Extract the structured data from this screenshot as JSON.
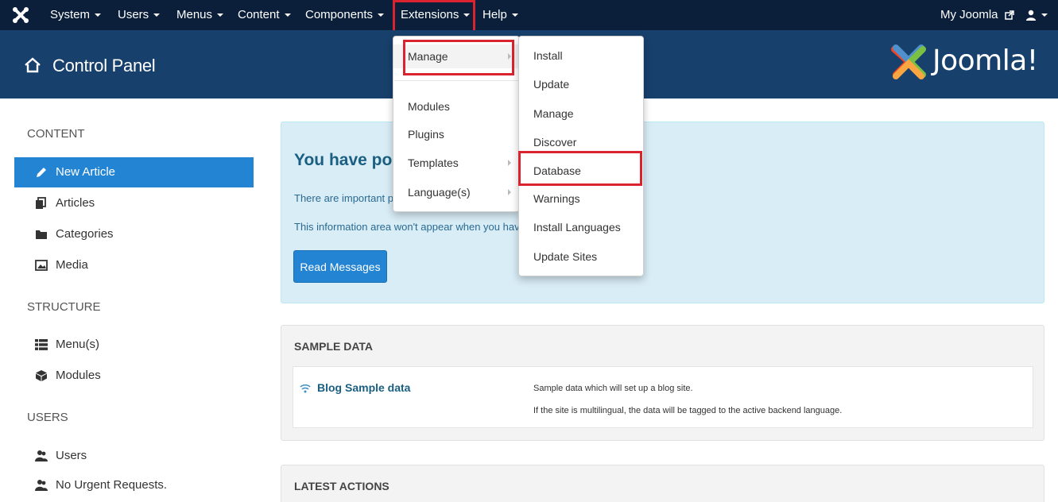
{
  "navbar": {
    "menus": [
      "System",
      "Users",
      "Menus",
      "Content",
      "Components",
      "Extensions",
      "Help"
    ],
    "my_joomla": "My Joomla"
  },
  "header": {
    "title": "Control Panel",
    "brand": "Joomla!"
  },
  "sidebar": {
    "content_heading": "CONTENT",
    "structure_heading": "STRUCTURE",
    "users_heading": "USERS",
    "content_items": [
      "New Article",
      "Articles",
      "Categories",
      "Media"
    ],
    "structure_items": [
      "Menu(s)",
      "Modules"
    ],
    "users_items": [
      "Users",
      "No Urgent Requests."
    ]
  },
  "alert": {
    "title": "You have post-",
    "line1": "There are important p",
    "line2": "This information area won't appear when you have",
    "button": "Read Messages"
  },
  "sample_data": {
    "heading": "SAMPLE DATA",
    "link": "Blog Sample data",
    "desc1": "Sample data which will set up a blog site.",
    "desc2": "If the site is multilingual, the data will be tagged to the active backend language."
  },
  "latest_actions": {
    "heading": "LATEST ACTIONS"
  },
  "extensions_menu": {
    "items": [
      "Manage",
      "Modules",
      "Plugins",
      "Templates",
      "Language(s)"
    ]
  },
  "manage_submenu": {
    "items": [
      "Install",
      "Update",
      "Manage",
      "Discover",
      "Database",
      "Warnings",
      "Install Languages",
      "Update Sites"
    ]
  },
  "colors": {
    "navbar": "#0b1f3a",
    "header": "#18406c",
    "active": "#2384d3",
    "highlight": "#d9232e",
    "alert_bg": "#d9edf7"
  }
}
